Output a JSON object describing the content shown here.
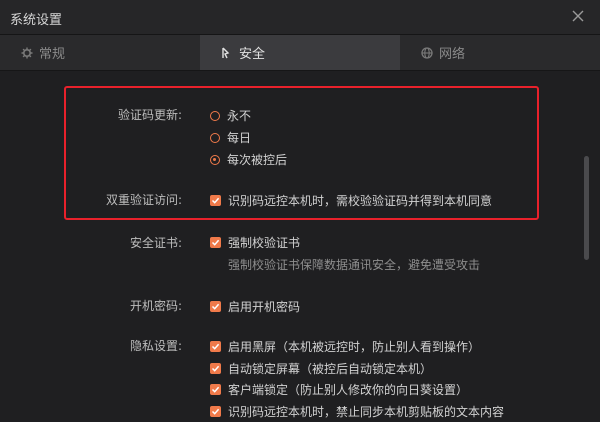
{
  "window": {
    "title": "系统设置"
  },
  "tabs": [
    {
      "label": "常规",
      "icon": "gear-icon",
      "active": false
    },
    {
      "label": "安全",
      "icon": "shield-icon",
      "active": true
    },
    {
      "label": "网络",
      "icon": "globe-icon",
      "active": false
    }
  ],
  "security": {
    "code_update": {
      "label": "验证码更新:",
      "options": [
        "永不",
        "每日",
        "每次被控后"
      ],
      "selected": "每次被控后"
    },
    "two_factor": {
      "label": "双重验证访问:",
      "option": "识别码远控本机时，需校验验证码并得到本机同意",
      "checked": true
    },
    "certificate": {
      "label": "安全证书:",
      "option": "强制校验证书",
      "checked": true,
      "hint": "强制校验证书保障数据通讯安全，避免遭受攻击"
    },
    "boot_password": {
      "label": "开机密码:",
      "option": "启用开机密码",
      "checked": true
    },
    "privacy": {
      "label": "隐私设置:",
      "options": [
        {
          "text": "启用黑屏（本机被远控时，防止别人看到操作）",
          "checked": true
        },
        {
          "text": "自动锁定屏幕（被控后自动锁定本机）",
          "checked": true
        },
        {
          "text": "客户端锁定（防止别人修改你的向日葵设置）",
          "checked": true
        },
        {
          "text": "识别码远控本机时，禁止同步本机剪贴板的文本内容",
          "checked": true
        }
      ]
    }
  },
  "colors": {
    "accent": "#f07a4a",
    "highlight_box": "#e8212b",
    "background": "#1f1f21"
  }
}
